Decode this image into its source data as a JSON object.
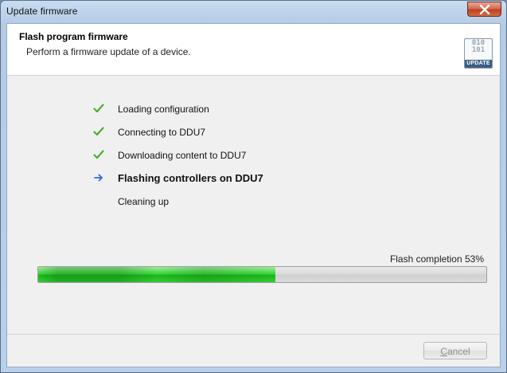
{
  "window": {
    "title": "Update firmware"
  },
  "header": {
    "title": "Flash program firmware",
    "subtitle": "Perform a firmware update of a device.",
    "icon": {
      "name": "firmware-update-icon",
      "bits": [
        "010",
        "101"
      ],
      "tag": "UPDATE"
    }
  },
  "steps": [
    {
      "label": "Loading configuration",
      "state": "done"
    },
    {
      "label": "Connecting to DDU7",
      "state": "done"
    },
    {
      "label": "Downloading content to DDU7",
      "state": "done"
    },
    {
      "label": "Flashing controllers on DDU7",
      "state": "active"
    },
    {
      "label": "Cleaning up",
      "state": "pending"
    }
  ],
  "progress": {
    "caption": "Flash completion 53%",
    "value_percent": 53
  },
  "buttons": {
    "cancel_accel": "C",
    "cancel_rest": "ancel",
    "cancel_enabled": false
  },
  "colors": {
    "check": "#4caf2a",
    "arrow": "#2e6fd6",
    "progress": "#27c427"
  }
}
